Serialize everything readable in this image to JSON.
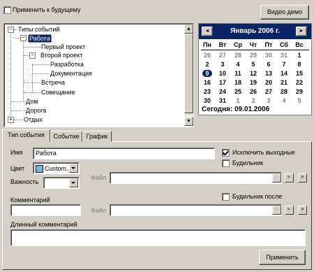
{
  "top": {
    "apply_future_label": "Применить к будущему",
    "apply_future_checked": false,
    "video_demo_label": "Видео демо"
  },
  "tree": {
    "root": "Типы событий",
    "work": "Работа",
    "first_project": "Первый проект",
    "second_project": "Второй проект",
    "development": "Разработка",
    "documentation": "Документация",
    "meeting_short": "Встреча",
    "meeting": "Совещание",
    "home": "Дом",
    "road": "Дорога",
    "rest": "Отдых"
  },
  "calendar": {
    "month_title": "Январь 2006 г.",
    "prev_icon": "◄",
    "next_icon": "►",
    "weekdays": [
      "Пн",
      "Вт",
      "Ср",
      "Чт",
      "Пт",
      "Сб",
      "Вс"
    ],
    "weeks": [
      [
        "26",
        "27",
        "28",
        "29",
        "30",
        "31",
        "1"
      ],
      [
        "2",
        "3",
        "4",
        "5",
        "6",
        "7",
        "8"
      ],
      [
        "9",
        "10",
        "11",
        "12",
        "13",
        "14",
        "15"
      ],
      [
        "16",
        "17",
        "18",
        "19",
        "20",
        "21",
        "22"
      ],
      [
        "23",
        "24",
        "25",
        "26",
        "27",
        "28",
        "29"
      ],
      [
        "30",
        "31",
        "1",
        "2",
        "3",
        "4",
        "5"
      ]
    ],
    "today_label": "Сегодня: 09.01.2006",
    "selected": "9",
    "header_color": "#0a246a"
  },
  "tabs": [
    {
      "label": "Тип события"
    },
    {
      "label": "Событие"
    },
    {
      "label": "График"
    }
  ],
  "form": {
    "name_label": "Имя",
    "name_value": "Работа",
    "color_label": "Цвет",
    "color_value": "Custom...",
    "color_swatch": "#6fb7e8",
    "importance_label": "Важность",
    "file_label_1": "Файл",
    "file_label_2": "Файл",
    "exclude_weekends_label": "Исключить выходные",
    "exclude_weekends_checked": true,
    "alarm_label": "Будильник",
    "alarm_checked": false,
    "alarm_after_label": "Будильник после",
    "alarm_after_checked": false,
    "comment_label": "Комментарий",
    "long_comment_label": "Длинный комментарий",
    "browse_icon": "···",
    "play_icon": "►",
    "stop_icon": "■",
    "apply_label": "Применить"
  }
}
